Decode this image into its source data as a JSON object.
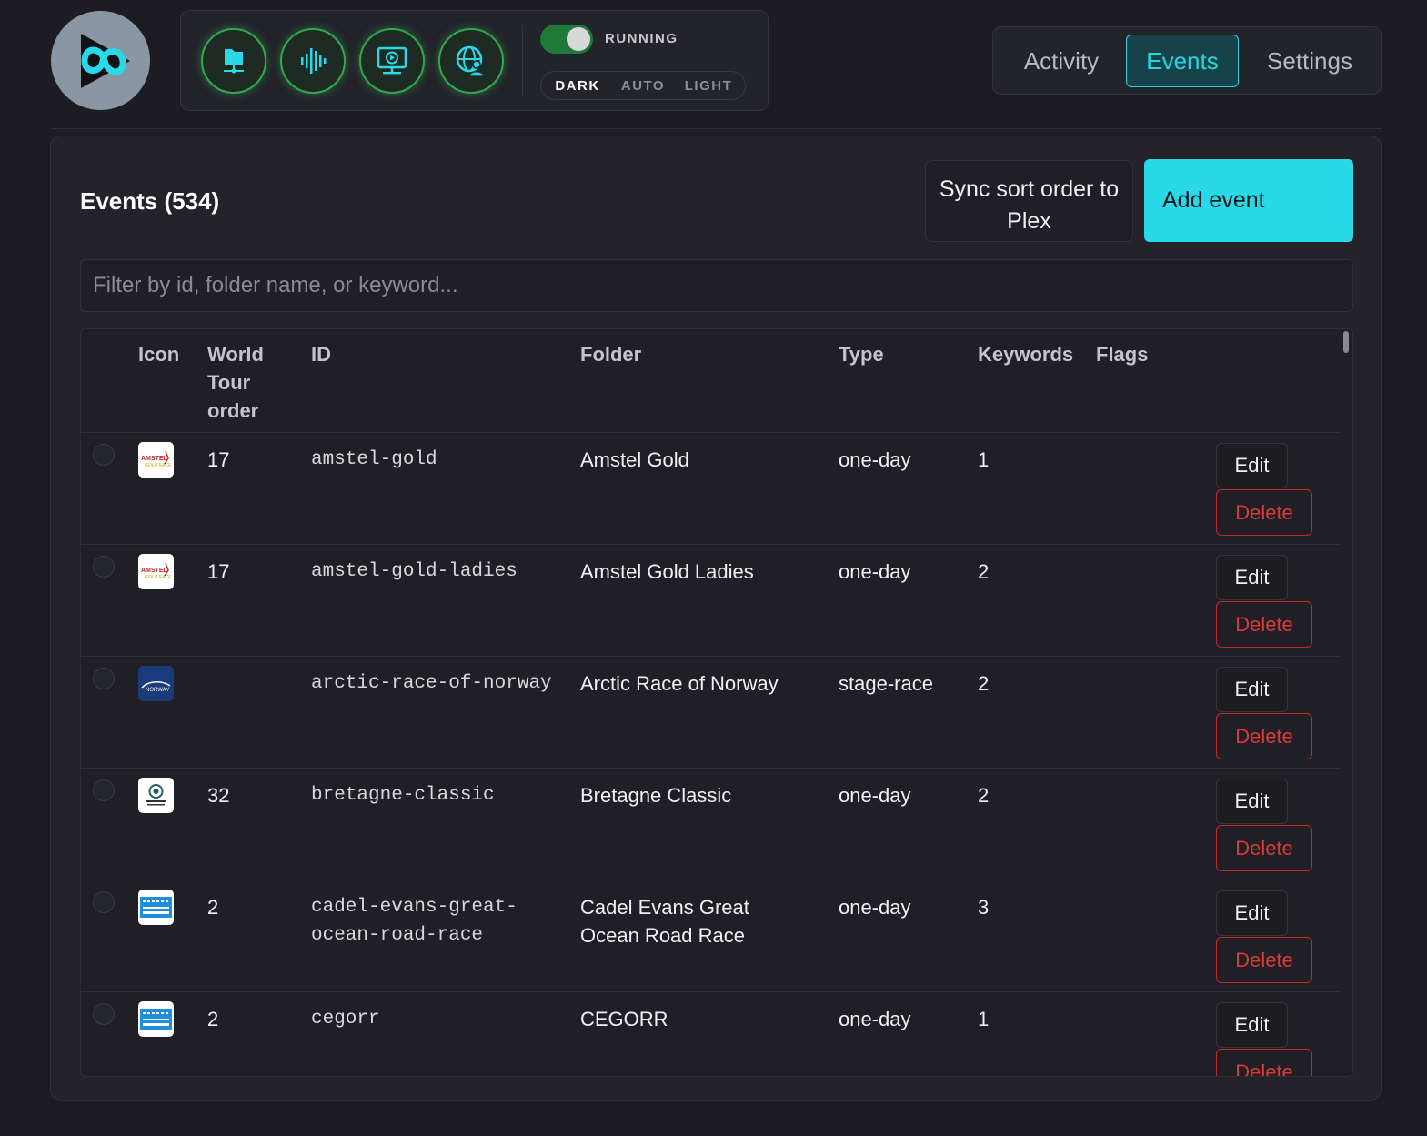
{
  "toolbar": {
    "tools": [
      {
        "icon": "folder-network-icon",
        "label": ""
      },
      {
        "icon": "audio-waveform-icon",
        "label": ""
      },
      {
        "icon": "video-display-icon",
        "label": ""
      },
      {
        "icon": "global-users-icon",
        "label": ""
      }
    ],
    "status_label": "RUNNING",
    "status_on": true,
    "theme_options": [
      "DARK",
      "AUTO",
      "LIGHT"
    ],
    "theme_selected": "DARK"
  },
  "nav": {
    "items": [
      "Activity",
      "Events",
      "Settings"
    ],
    "active": "Events"
  },
  "panel": {
    "title": "Events (534)",
    "sync_button": "Sync sort order to Plex",
    "add_button": "Add event",
    "filter_placeholder": "Filter by id, folder name, or keyword..."
  },
  "table": {
    "headers": {
      "icon": "Icon",
      "world_tour_order": "World Tour order",
      "id": "ID",
      "folder": "Folder",
      "type": "Type",
      "keywords": "Keywords",
      "flags": "Flags"
    },
    "rows": [
      {
        "icon": "amstel-logo",
        "order": "17",
        "id": "amstel-gold",
        "folder": "Amstel Gold",
        "type": "one-day",
        "keywords": "1",
        "edit": "Edit",
        "delete": "Delete"
      },
      {
        "icon": "amstel-logo",
        "order": "17",
        "id": "amstel-gold-ladies",
        "folder": "Amstel Gold Ladies",
        "type": "one-day",
        "keywords": "2",
        "edit": "Edit",
        "delete": "Delete"
      },
      {
        "icon": "arctic-logo",
        "order": "",
        "id": "arctic-race-of-norway",
        "folder": "Arctic Race of Norway",
        "type": "stage-race",
        "keywords": "2",
        "edit": "Edit",
        "delete": "Delete"
      },
      {
        "icon": "bretagne-logo",
        "order": "32",
        "id": "bretagne-classic",
        "folder": "Bretagne Classic",
        "type": "one-day",
        "keywords": "2",
        "edit": "Edit",
        "delete": "Delete"
      },
      {
        "icon": "cadel-logo",
        "order": "2",
        "id": "cadel-evans-great-ocean-road-race",
        "folder": "Cadel Evans Great Ocean Road Race",
        "type": "one-day",
        "keywords": "3",
        "edit": "Edit",
        "delete": "Delete"
      },
      {
        "icon": "cadel-logo",
        "order": "2",
        "id": "cegorr",
        "folder": "CEGORR",
        "type": "one-day",
        "keywords": "1",
        "edit": "Edit",
        "delete": "Delete"
      }
    ]
  },
  "colors": {
    "accent": "#2ad9e8",
    "danger": "#d83a3a",
    "running": "#1f7a3a"
  }
}
